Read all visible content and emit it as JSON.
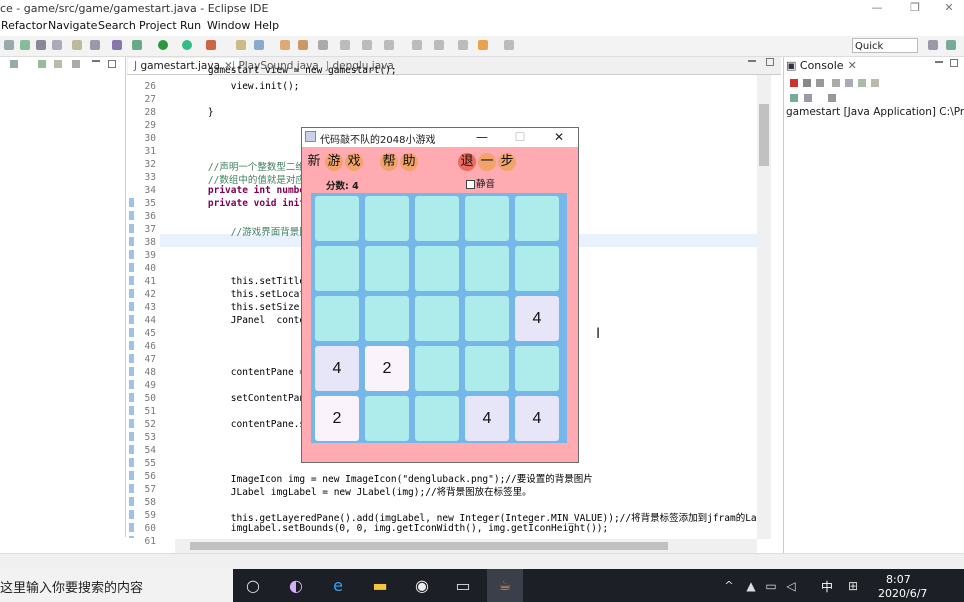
{
  "window": {
    "title": "ce - game/src/game/gamestart.java - Eclipse IDE"
  },
  "menu": [
    "Refactor",
    "Navigate",
    "Search",
    "Project",
    "Run",
    "Window",
    "Help"
  ],
  "toolbar": {
    "quick_access": "Quick Access"
  },
  "editor": {
    "tabs": [
      {
        "label": "gamestart.java",
        "active": true
      },
      {
        "label": "PlaySound.java",
        "active": false
      },
      {
        "label": "denglu.java",
        "active": false
      }
    ],
    "lines": [
      {
        "n": "26",
        "text": "        view.init();"
      },
      {
        "n": "27",
        "text": ""
      },
      {
        "n": "28",
        "text": "    }"
      },
      {
        "n": "29",
        "text": ""
      },
      {
        "n": "30",
        "text": ""
      },
      {
        "n": "31",
        "text": ""
      },
      {
        "n": "32",
        "text": "    //声明一个整数型二维"
      },
      {
        "n": "33",
        "text": "    //数组中的值就是对应"
      },
      {
        "n": "34",
        "text": "    private int numbers"
      },
      {
        "n": "35",
        "text": "    private void init()"
      },
      {
        "n": "36",
        "text": ""
      },
      {
        "n": "37",
        "text": "        //游戏界面背景图"
      },
      {
        "n": "38",
        "text": ""
      },
      {
        "n": "39",
        "text": ""
      },
      {
        "n": "40",
        "text": ""
      },
      {
        "n": "41",
        "text": "        this.setTitle(\""
      },
      {
        "n": "42",
        "text": "        this.setLocatio"
      },
      {
        "n": "43",
        "text": "        this.setSize(50"
      },
      {
        "n": "44",
        "text": "        JPanel  content"
      },
      {
        "n": "45",
        "text": ""
      },
      {
        "n": "46",
        "text": ""
      },
      {
        "n": "47",
        "text": ""
      },
      {
        "n": "48",
        "text": "        contentPane = n"
      },
      {
        "n": "49",
        "text": ""
      },
      {
        "n": "50",
        "text": "        setContentPane("
      },
      {
        "n": "51",
        "text": ""
      },
      {
        "n": "52",
        "text": "        contentPane.set"
      },
      {
        "n": "53",
        "text": ""
      },
      {
        "n": "54",
        "text": ""
      },
      {
        "n": "55",
        "text": ""
      },
      {
        "n": "56",
        "text": "        ImageIcon img = new ImageIcon(\"dengluback.png\");//要设置的背景图片"
      },
      {
        "n": "57",
        "text": "        JLabel imgLabel = new JLabel(img);//将背景图放在标签里。"
      },
      {
        "n": "58",
        "text": ""
      },
      {
        "n": "59",
        "text": "        this.getLayeredPane().add(imgLabel, new Integer(Integer.MIN_VALUE));//将背景标签添加到jfram的La"
      },
      {
        "n": "60",
        "text": "        imgLabel.setBounds(0, 0, img.getIconWidth(), img.getIconHeight());"
      },
      {
        "n": "61",
        "text": ""
      }
    ]
  },
  "console": {
    "tab_label": "Console",
    "text": "gamestart [Java Application] C:\\Pro"
  },
  "game": {
    "title": "代码敲不队的2048小游戏",
    "buttons": {
      "new_game": [
        "新",
        "游",
        "戏"
      ],
      "help": [
        "帮",
        "助"
      ],
      "undo": [
        "退",
        "一",
        "步"
      ]
    },
    "score_label": "分数: 4",
    "mute_label": "静音",
    "mute_checked": false,
    "grid": [
      [
        "",
        "",
        "",
        "",
        ""
      ],
      [
        "",
        "",
        "",
        "",
        ""
      ],
      [
        "",
        "",
        "",
        "",
        "4"
      ],
      [
        "4",
        "2",
        "",
        "",
        ""
      ],
      [
        "2",
        "",
        "",
        "4",
        "4"
      ]
    ],
    "colors": {
      "background": "#ffabb1",
      "board": "#75b7e8",
      "empty_tile": "#aeeceb",
      "tile_2": "#fbf3fb",
      "tile_4": "#e6e6f8",
      "button_circle": "#f2a36a"
    }
  },
  "taskbar": {
    "search_placeholder": "这里输入你要搜索的内容",
    "ime": "中",
    "time": "8:07",
    "date": "2020/6/7"
  }
}
